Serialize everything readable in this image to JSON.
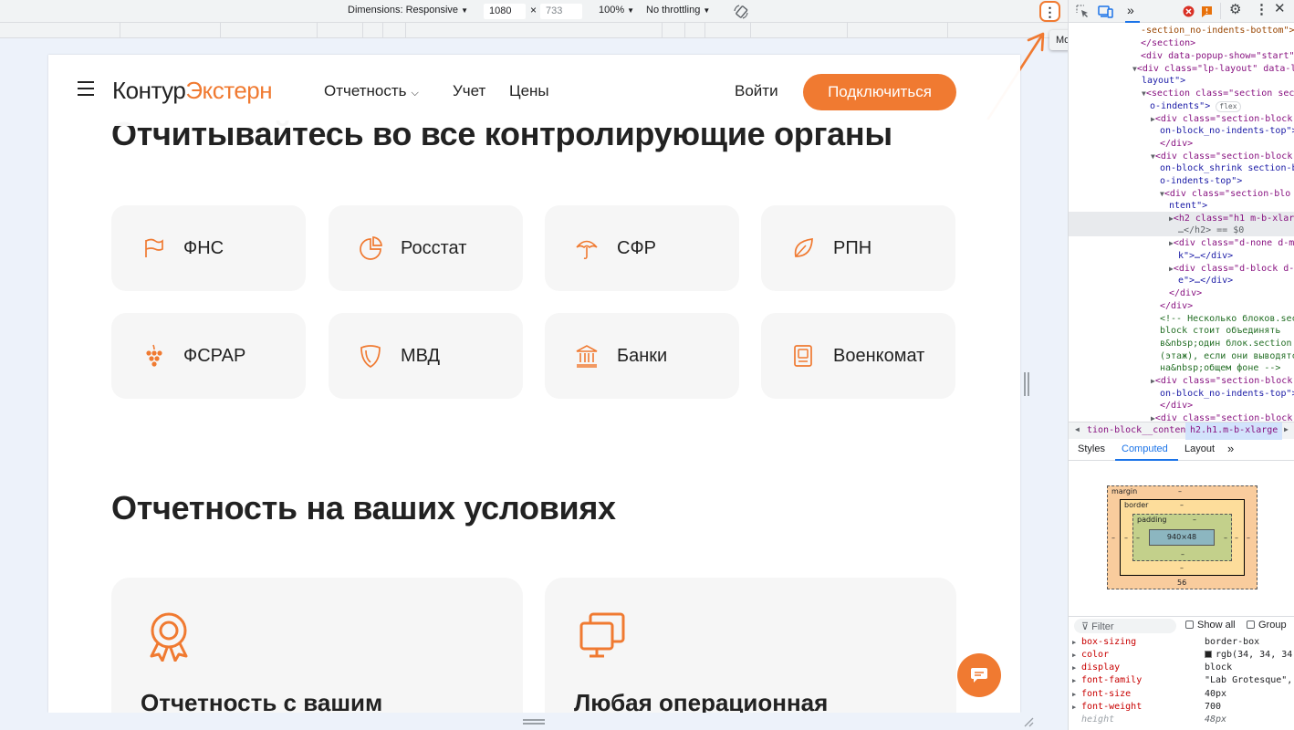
{
  "device_toolbar": {
    "dimensions_label": "Dimensions: Responsive",
    "width": "1080",
    "times": "×",
    "height_placeholder": "733",
    "zoom": "100%",
    "throttling": "No throttling",
    "more_options_tooltip": "More options"
  },
  "site": {
    "logo_primary": "Контур",
    "logo_secondary": "Экстерн",
    "nav": [
      {
        "label": "Отчетность"
      },
      {
        "label": "Учет"
      },
      {
        "label": "Цены"
      }
    ],
    "login": "Войти",
    "cta": "Подключиться",
    "heading_authorities": "Отчитывайтесь во все контролирующие органы",
    "authorities": [
      {
        "label": "ФНС",
        "icon": "flag-icon"
      },
      {
        "label": "Росстат",
        "icon": "pie-chart-icon"
      },
      {
        "label": "СФР",
        "icon": "umbrella-icon"
      },
      {
        "label": "РПН",
        "icon": "leaf-icon"
      },
      {
        "label": "ФСРАР",
        "icon": "grapes-icon"
      },
      {
        "label": "МВД",
        "icon": "shield-icon"
      },
      {
        "label": "Банки",
        "icon": "bank-icon"
      },
      {
        "label": "Военкомат",
        "icon": "id-card-icon"
      }
    ],
    "heading_terms": "Отчетность на ваших условиях",
    "cards": [
      {
        "title": "Отчетность с вашим",
        "icon": "award-icon"
      },
      {
        "title": "Любая операционная",
        "icon": "monitors-icon"
      }
    ],
    "accent_color": "#f07a31"
  },
  "devtools": {
    "elements": [
      "-section_no-indents-bottom\">",
      "</section>",
      "<div data-popup-show=\"start\">",
      "<div class=\"lp-layout\" data-l",
      "layout\">",
      "<section class=\"section sec",
      "o-indents\">",
      "flex",
      "<div class=\"section-block",
      "on-block_no-indents-top\">",
      "</div>",
      "<div class=\"section-block",
      "on-block_shrink section-b",
      "o-indents-top\">",
      "<div class=\"section-blo",
      "ntent\">",
      "<h2 class=\"h1 m-b-xlar",
      "…</h2> == $0",
      "<div class=\"d-none d-m",
      "k\">…</div>",
      "<div class=\"d-block d-",
      "e\">…</div>",
      "</div>",
      "</div>",
      "<!-- Несколько блоков.sec",
      "block стоит объединять",
      "в&nbsp;один блок.section",
      "(этаж), если они выводятс",
      "на&nbsp;общем фоне -->",
      "<div class=\"section-block",
      "on-block_no-indents-top\">",
      "</div>",
      "<div class=\"section-block"
    ],
    "breadcrumbs": [
      "tion-block__content",
      "h2.h1.m-b-xlarge"
    ],
    "tabs": [
      "Styles",
      "Computed",
      "Layout",
      "»"
    ],
    "box_model": {
      "margin_label": "margin",
      "border_label": "border",
      "padding_label": "padding",
      "content": "940×48",
      "dash": "–",
      "margin_bottom": "56"
    },
    "filter_placeholder": "Filter",
    "show_all": "Show all",
    "group": "Group",
    "properties": [
      {
        "name": "box-sizing",
        "value": "border-box"
      },
      {
        "name": "color",
        "value": "rgb(34, 34, 34)"
      },
      {
        "name": "display",
        "value": "block"
      },
      {
        "name": "font-family",
        "value": "\"Lab Grotesque\","
      },
      {
        "name": "font-size",
        "value": "40px"
      },
      {
        "name": "font-weight",
        "value": "700"
      },
      {
        "name": "height",
        "value": "48px"
      }
    ]
  }
}
